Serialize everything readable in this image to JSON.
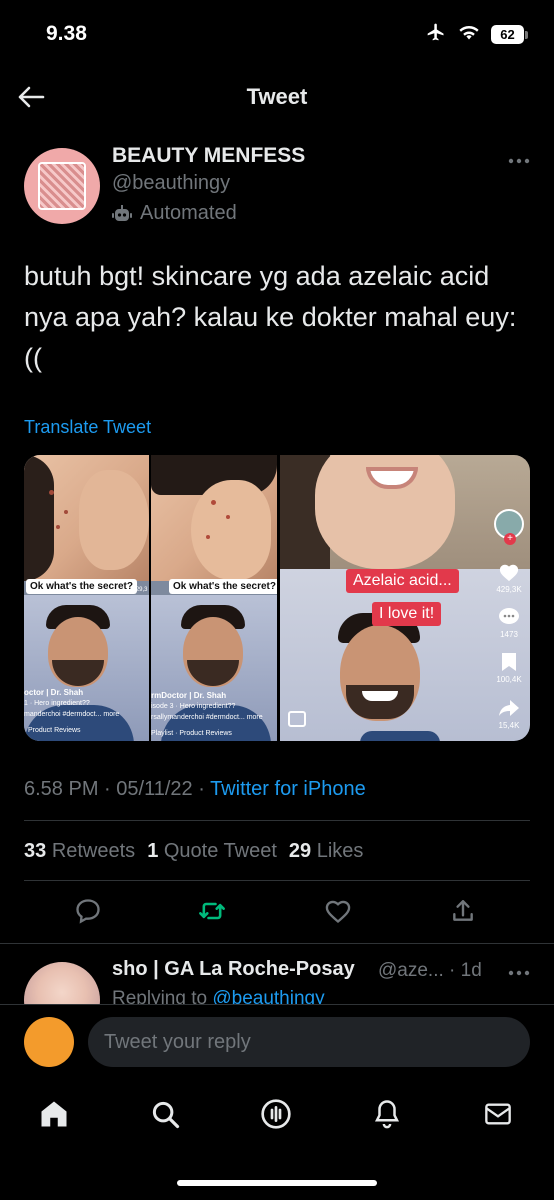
{
  "status_bar": {
    "time": "9.38",
    "battery": "62"
  },
  "header": {
    "title": "Tweet"
  },
  "tweet": {
    "author_name": "BEAUTY MENFESS",
    "handle": "@beauthingy",
    "automated_label": "Automated",
    "text": "butuh bgt! skincare yg ada azelaic acid nya apa yah? kalau ke dokter mahal euy:((",
    "translate": "Translate Tweet",
    "time": "6.58 PM",
    "date": "05/11/22",
    "source": "Twitter for iPhone",
    "retweets_count": "33",
    "retweets_label": "Retweets",
    "quotes_count": "1",
    "quotes_label": "Quote Tweet",
    "likes_count": "29",
    "likes_label": "Likes"
  },
  "media": {
    "caption_1": "Ok what's the secret?",
    "caption_2": "Ok what's the secret?",
    "red_caption_1": "Azelaic acid...",
    "red_caption_2": "I love it!",
    "panel1_user": "octor | Dr. Shah",
    "panel1_sub": "1 · Hero ingredient??",
    "panel1_tags": "manderchoi #dermdoct... more",
    "panel1_playlist": "Product Reviews",
    "panel2_user": "rmDoctor | Dr. Shah",
    "panel2_sub": "isode 3 · Hero ingredient??",
    "panel2_tags": "rsallymanderchoi #dermdoct... more",
    "panel2_playlist": "Playlist · Product Reviews",
    "side_likes": "429,3K",
    "side_comments": "1473",
    "side_saves": "100,4K",
    "side_shares": "15,4K",
    "left_side_likes": "429,3"
  },
  "reply": {
    "name": "sho | GA La Roche-Posay",
    "handle": "@aze... · 1d",
    "replying_prefix": "Replying to",
    "replying_to": "@beauthingy"
  },
  "composer": {
    "placeholder": "Tweet your reply"
  },
  "tabbar": {
    "items": [
      "home-icon",
      "search-icon",
      "spaces-icon",
      "notifications-icon",
      "messages-icon"
    ]
  }
}
